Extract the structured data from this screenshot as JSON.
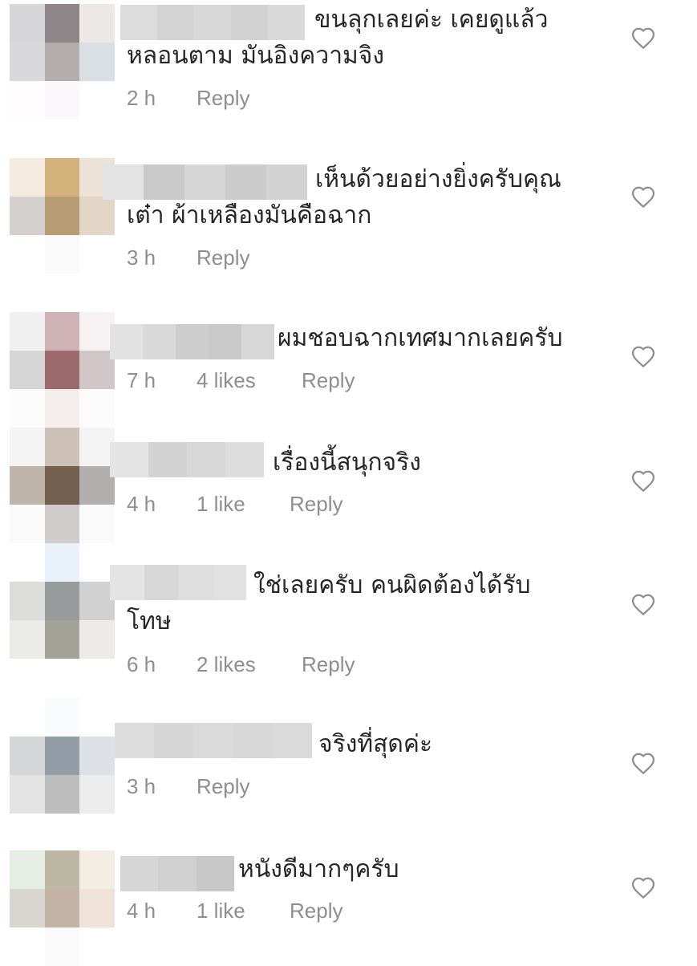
{
  "comments": [
    {
      "text_line1": "ขนลุกเลยค่ะ เคยดูแล้ว",
      "text_line2": "หลอนตาม มันอิงความจิง",
      "time": "2 h",
      "likes": "",
      "reply_label": "Reply",
      "avatar_tiles": [
        "#d6d5d7",
        "#8e8589",
        "#ebe8e5",
        "#d8d7d9",
        "#b3aeac",
        "#d9dfe3",
        "#fffdfd",
        "#faf8fa",
        "#ffffff"
      ]
    },
    {
      "text_line1": "เห็นด้วยอย่างยิ่งครับคุณ",
      "text_line2": "เต๋า ผ้าเหลืองมันคือฉาก",
      "time": "3 h",
      "likes": "",
      "reply_label": "Reply",
      "avatar_tiles": [
        "#f3ebdf",
        "#d3b27b",
        "#ece3d6",
        "#d4d0cd",
        "#b89c74",
        "#e2d6c6",
        "#ffffff",
        "#fafafa",
        "#ffffff"
      ]
    },
    {
      "text_line1": "ผมชอบฉากเทศมากเลยครับ",
      "text_line2": "",
      "time": "7 h",
      "likes": "4 likes",
      "reply_label": "Reply",
      "avatar_tiles": [
        "#f1f0f0",
        "#cfb2b6",
        "#f6f2f3",
        "#d6d5d5",
        "#9d6a6c",
        "#d0c6c7",
        "#fdfcfc",
        "#f6eeee",
        "#fdfcfc"
      ]
    },
    {
      "text_line1": "เรื่องนี้สนุกจริง",
      "text_line2": "",
      "time": "4 h",
      "likes": "1 like",
      "reply_label": "Reply",
      "avatar_tiles": [
        "#f5f4f4",
        "#cdc0b6",
        "#f4f3f3",
        "#bfb5aa",
        "#73604f",
        "#b2afaf",
        "#fafafa",
        "#d0cccb",
        "#fafafa"
      ]
    },
    {
      "text_line1": "ใช่เลยครับ คนผิดต้องได้รับ",
      "text_line2": "โทษ",
      "time": "6 h",
      "likes": "2 likes",
      "reply_label": "Reply",
      "avatar_tiles": [
        "#ffffff",
        "#e9f1f9",
        "#ffffff",
        "#dcdcdb",
        "#979b9b",
        "#d2d1d2",
        "#ebebe8",
        "#a3a398",
        "#ecebe8"
      ]
    },
    {
      "text_line1": "จริงที่สุดค่ะ",
      "text_line2": "",
      "time": "3 h",
      "likes": "",
      "reply_label": "Reply",
      "avatar_tiles": [
        "#ffffff",
        "#fafbfd",
        "#ffffff",
        "#d5d6d8",
        "#949ca7",
        "#dde0e4",
        "#e4e4e4",
        "#bfbebe",
        "#ececec"
      ]
    },
    {
      "text_line1": "หนังดีมากๆครับ",
      "text_line2": "",
      "time": "4 h",
      "likes": "1 like",
      "reply_label": "Reply",
      "avatar_tiles": [
        "#e6ede4",
        "#bdb8a3",
        "#f3ede4",
        "#d9d6d2",
        "#c3b3a5",
        "#efe3d9",
        "#ffffff",
        "#fafafa",
        "#ffffff"
      ]
    }
  ],
  "colors": {
    "text": "#262626",
    "secondary": "#8e8e8e",
    "heart_stroke": "#8e8e8e"
  },
  "icons": {
    "like": "heart-outline-icon"
  }
}
